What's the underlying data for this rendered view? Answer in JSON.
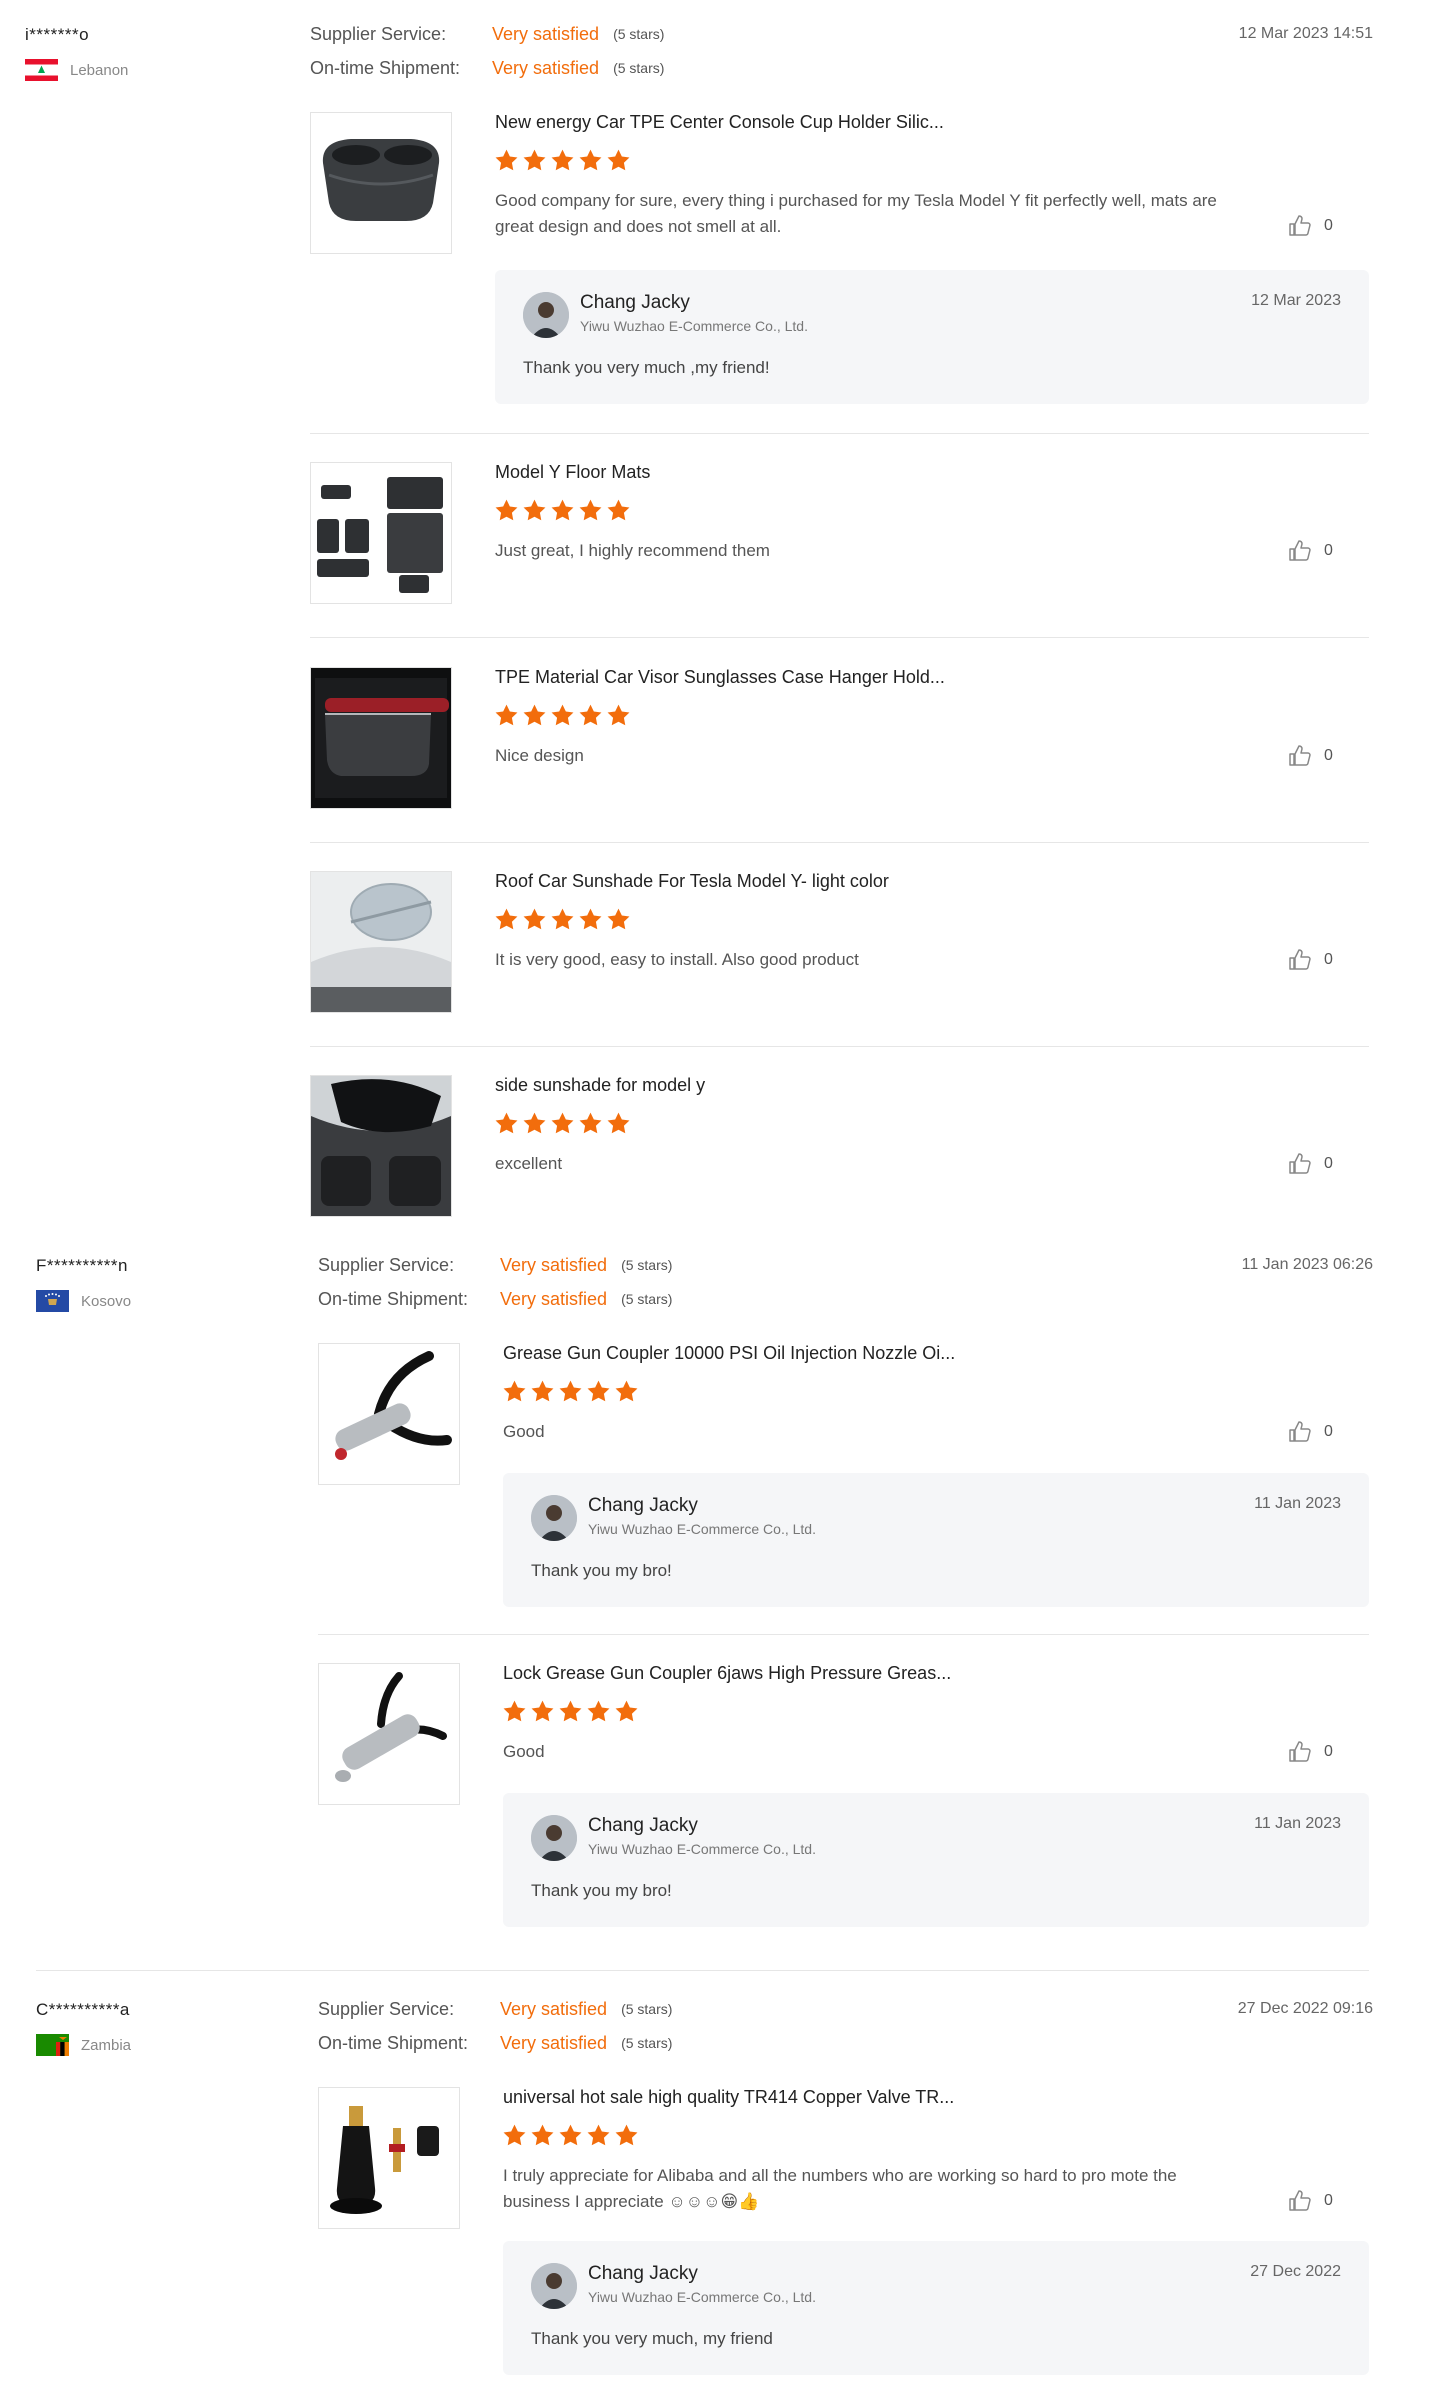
{
  "reviews": [
    {
      "buyer": "i*******o",
      "country": "Lebanon",
      "flag": "lebanon",
      "supplier_service_label": "Supplier Service:",
      "shipment_label": "On-time Shipment:",
      "supplier_service_value": "Very satisfied",
      "supplier_service_stars": "(5 stars)",
      "shipment_value": "Very satisfied",
      "shipment_stars": "(5 stars)",
      "date": "12 Mar 2023 14:51",
      "products": [
        {
          "title": "New energy Car TPE Center Console Cup Holder Silic...",
          "rating": 5,
          "text": "Good company for sure, every thing i purchased for my Tesla Model Y fit perfectly well, mats  are great design and does not smell at all.",
          "likes": "0",
          "image": "cup-holder",
          "reply": {
            "name": "Chang Jacky",
            "company": "Yiwu Wuzhao E-Commerce Co., Ltd.",
            "date": "12 Mar 2023",
            "text": "Thank you very much ,my friend!"
          }
        },
        {
          "title": "Model Y Floor Mats",
          "rating": 5,
          "text": "Just great, I highly recommend them",
          "likes": "0",
          "image": "floor-mats"
        },
        {
          "title": "TPE Material Car Visor Sunglasses Case Hanger Hold...",
          "rating": 5,
          "text": "Nice design",
          "likes": "0",
          "image": "visor-case"
        },
        {
          "title": "Roof Car Sunshade For Tesla Model Y- light color",
          "rating": 5,
          "text": "It is very good, easy to install. Also good product",
          "likes": "0",
          "image": "roof-sunshade"
        },
        {
          "title": "side sunshade for model y",
          "rating": 5,
          "text": "excellent",
          "likes": "0",
          "image": "side-sunshade"
        }
      ]
    },
    {
      "buyer": "F**********n",
      "country": "Kosovo",
      "flag": "kosovo",
      "supplier_service_label": "Supplier Service:",
      "shipment_label": "On-time Shipment:",
      "supplier_service_value": "Very satisfied",
      "supplier_service_stars": "(5 stars)",
      "shipment_value": "Very satisfied",
      "shipment_stars": "(5 stars)",
      "date": "11 Jan 2023 06:26",
      "products": [
        {
          "title": "Grease Gun Coupler 10000 PSI Oil Injection Nozzle Oi...",
          "rating": 5,
          "text": "Good",
          "likes": "0",
          "image": "grease-coupler",
          "reply": {
            "name": "Chang Jacky",
            "company": "Yiwu Wuzhao E-Commerce Co., Ltd.",
            "date": "11 Jan 2023",
            "text": "Thank you my bro!"
          }
        },
        {
          "title": "Lock Grease Gun Coupler 6jaws High Pressure Greas...",
          "rating": 5,
          "text": "Good",
          "likes": "0",
          "image": "lock-coupler",
          "reply": {
            "name": "Chang Jacky",
            "company": "Yiwu Wuzhao E-Commerce Co., Ltd.",
            "date": "11 Jan 2023",
            "text": "Thank you my bro!"
          }
        }
      ]
    },
    {
      "buyer": "C**********a",
      "country": "Zambia",
      "flag": "zambia",
      "supplier_service_label": "Supplier Service:",
      "shipment_label": "On-time Shipment:",
      "supplier_service_value": "Very satisfied",
      "supplier_service_stars": "(5 stars)",
      "shipment_value": "Very satisfied",
      "shipment_stars": "(5 stars)",
      "date": "27 Dec 2022 09:16",
      "products": [
        {
          "title": "universal hot sale high quality TR414 Copper Valve TR...",
          "rating": 5,
          "text": "I truly appreciate for Alibaba and all the numbers who are working so hard to pro mote the business I appreciate ☺☺☺😁👍",
          "likes": "0",
          "image": "valve-stem",
          "reply": {
            "name": "Chang Jacky",
            "company": "Yiwu Wuzhao E-Commerce Co., Ltd.",
            "date": "27 Dec 2022",
            "text": "Thank you very much, my friend"
          }
        }
      ]
    }
  ],
  "colors": {
    "accent": "#f26d0c",
    "star": "#f26d0c",
    "reply_bg": "#f5f6f8",
    "divider": "#e6e6e6"
  },
  "icons": {
    "star": "star-icon",
    "like": "thumbs-up-icon"
  }
}
